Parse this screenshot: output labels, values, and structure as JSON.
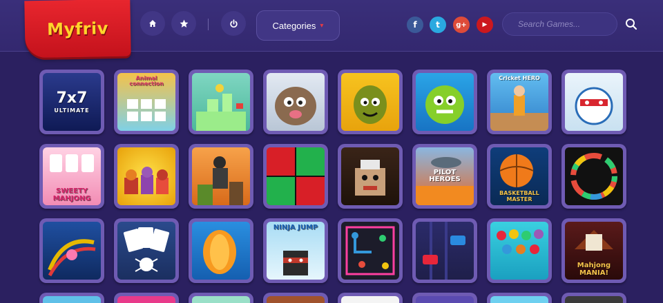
{
  "header": {
    "logo_text": "Myfriv",
    "nav_icons": [
      "home-icon",
      "star-icon",
      "power-icon"
    ],
    "categories_label": "Categories",
    "social": [
      {
        "name": "facebook",
        "glyph": "f",
        "color": "#3b5998"
      },
      {
        "name": "twitter",
        "glyph": "t",
        "color": "#2aa9e0"
      },
      {
        "name": "google-plus",
        "glyph": "g+",
        "color": "#dd4b39"
      },
      {
        "name": "youtube",
        "glyph": "▶",
        "color": "#cc181e"
      }
    ],
    "search_placeholder": "Search Games..."
  },
  "games": [
    {
      "label": "7x7",
      "sub": "ULTIMATE"
    },
    {
      "label": "Animal connection"
    },
    {
      "label": ""
    },
    {
      "label": ""
    },
    {
      "label": ""
    },
    {
      "label": ""
    },
    {
      "label": "Cricket HERO"
    },
    {
      "label": ""
    },
    {
      "label": "SWEETY MAHJONG"
    },
    {
      "label": ""
    },
    {
      "label": ""
    },
    {
      "label": ""
    },
    {
      "label": ""
    },
    {
      "label": "PILOT HEROES"
    },
    {
      "label": "BASKETBALL MASTER"
    },
    {
      "label": ""
    },
    {
      "label": ""
    },
    {
      "label": ""
    },
    {
      "label": ""
    },
    {
      "label": "NINJA JUMP"
    },
    {
      "label": ""
    },
    {
      "label": ""
    },
    {
      "label": ""
    },
    {
      "label": "Mahjong MANIA!"
    }
  ]
}
